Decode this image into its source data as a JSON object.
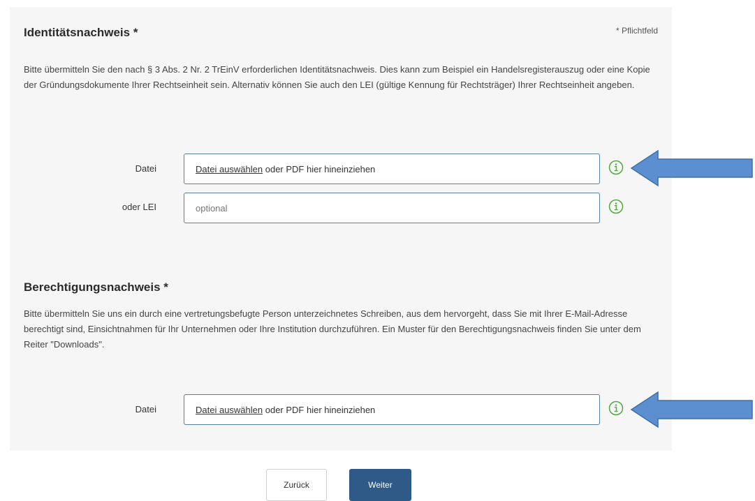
{
  "required_note": "* Pflichtfeld",
  "identity": {
    "title": "Identitätsnachweis *",
    "description": "Bitte übermitteln Sie den nach § 3 Abs. 2 Nr. 2 TrEinV erforderlichen Identitätsnachweis. Dies kann zum Beispiel ein Handelsregisterauszug oder eine Kopie der Gründungsdokumente Ihrer Rechtseinheit sein. Alternativ können Sie auch den LEI (gültige Kennung für Rechtsträger) Ihrer Rechtseinheit angeben.",
    "file_label": "Datei",
    "file_link": "Datei auswählen",
    "file_hint": " oder PDF hier hineinziehen",
    "lei_label": "oder LEI",
    "lei_placeholder": "optional",
    "lei_value": ""
  },
  "authorization": {
    "title": "Berechtigungsnachweis *",
    "description": "Bitte übermitteln Sie uns ein durch eine vertretungsbefugte Person unterzeichnetes Schreiben, aus dem hervorgeht, dass Sie mit Ihrer E-Mail-Adresse berechtigt sind, Einsichtnahmen für Ihr Unternehmen oder Ihre Institution durchzuführen. Ein Muster für den Berechtigungsnachweis finden Sie unter dem Reiter \"Downloads\".",
    "file_label": "Datei",
    "file_link": "Datei auswählen",
    "file_hint": " oder PDF hier hineinziehen"
  },
  "buttons": {
    "back": "Zurück",
    "next": "Weiter"
  },
  "colors": {
    "panel_bg": "#f6f6f6",
    "input_border": "#5a7fa6",
    "info_icon": "#4fa83d",
    "annotation_arrow": "#5b8fcf",
    "primary_button": "#2f5a88"
  },
  "icons": {
    "info": "info-circle-icon",
    "annotation": "arrow-left-icon"
  }
}
